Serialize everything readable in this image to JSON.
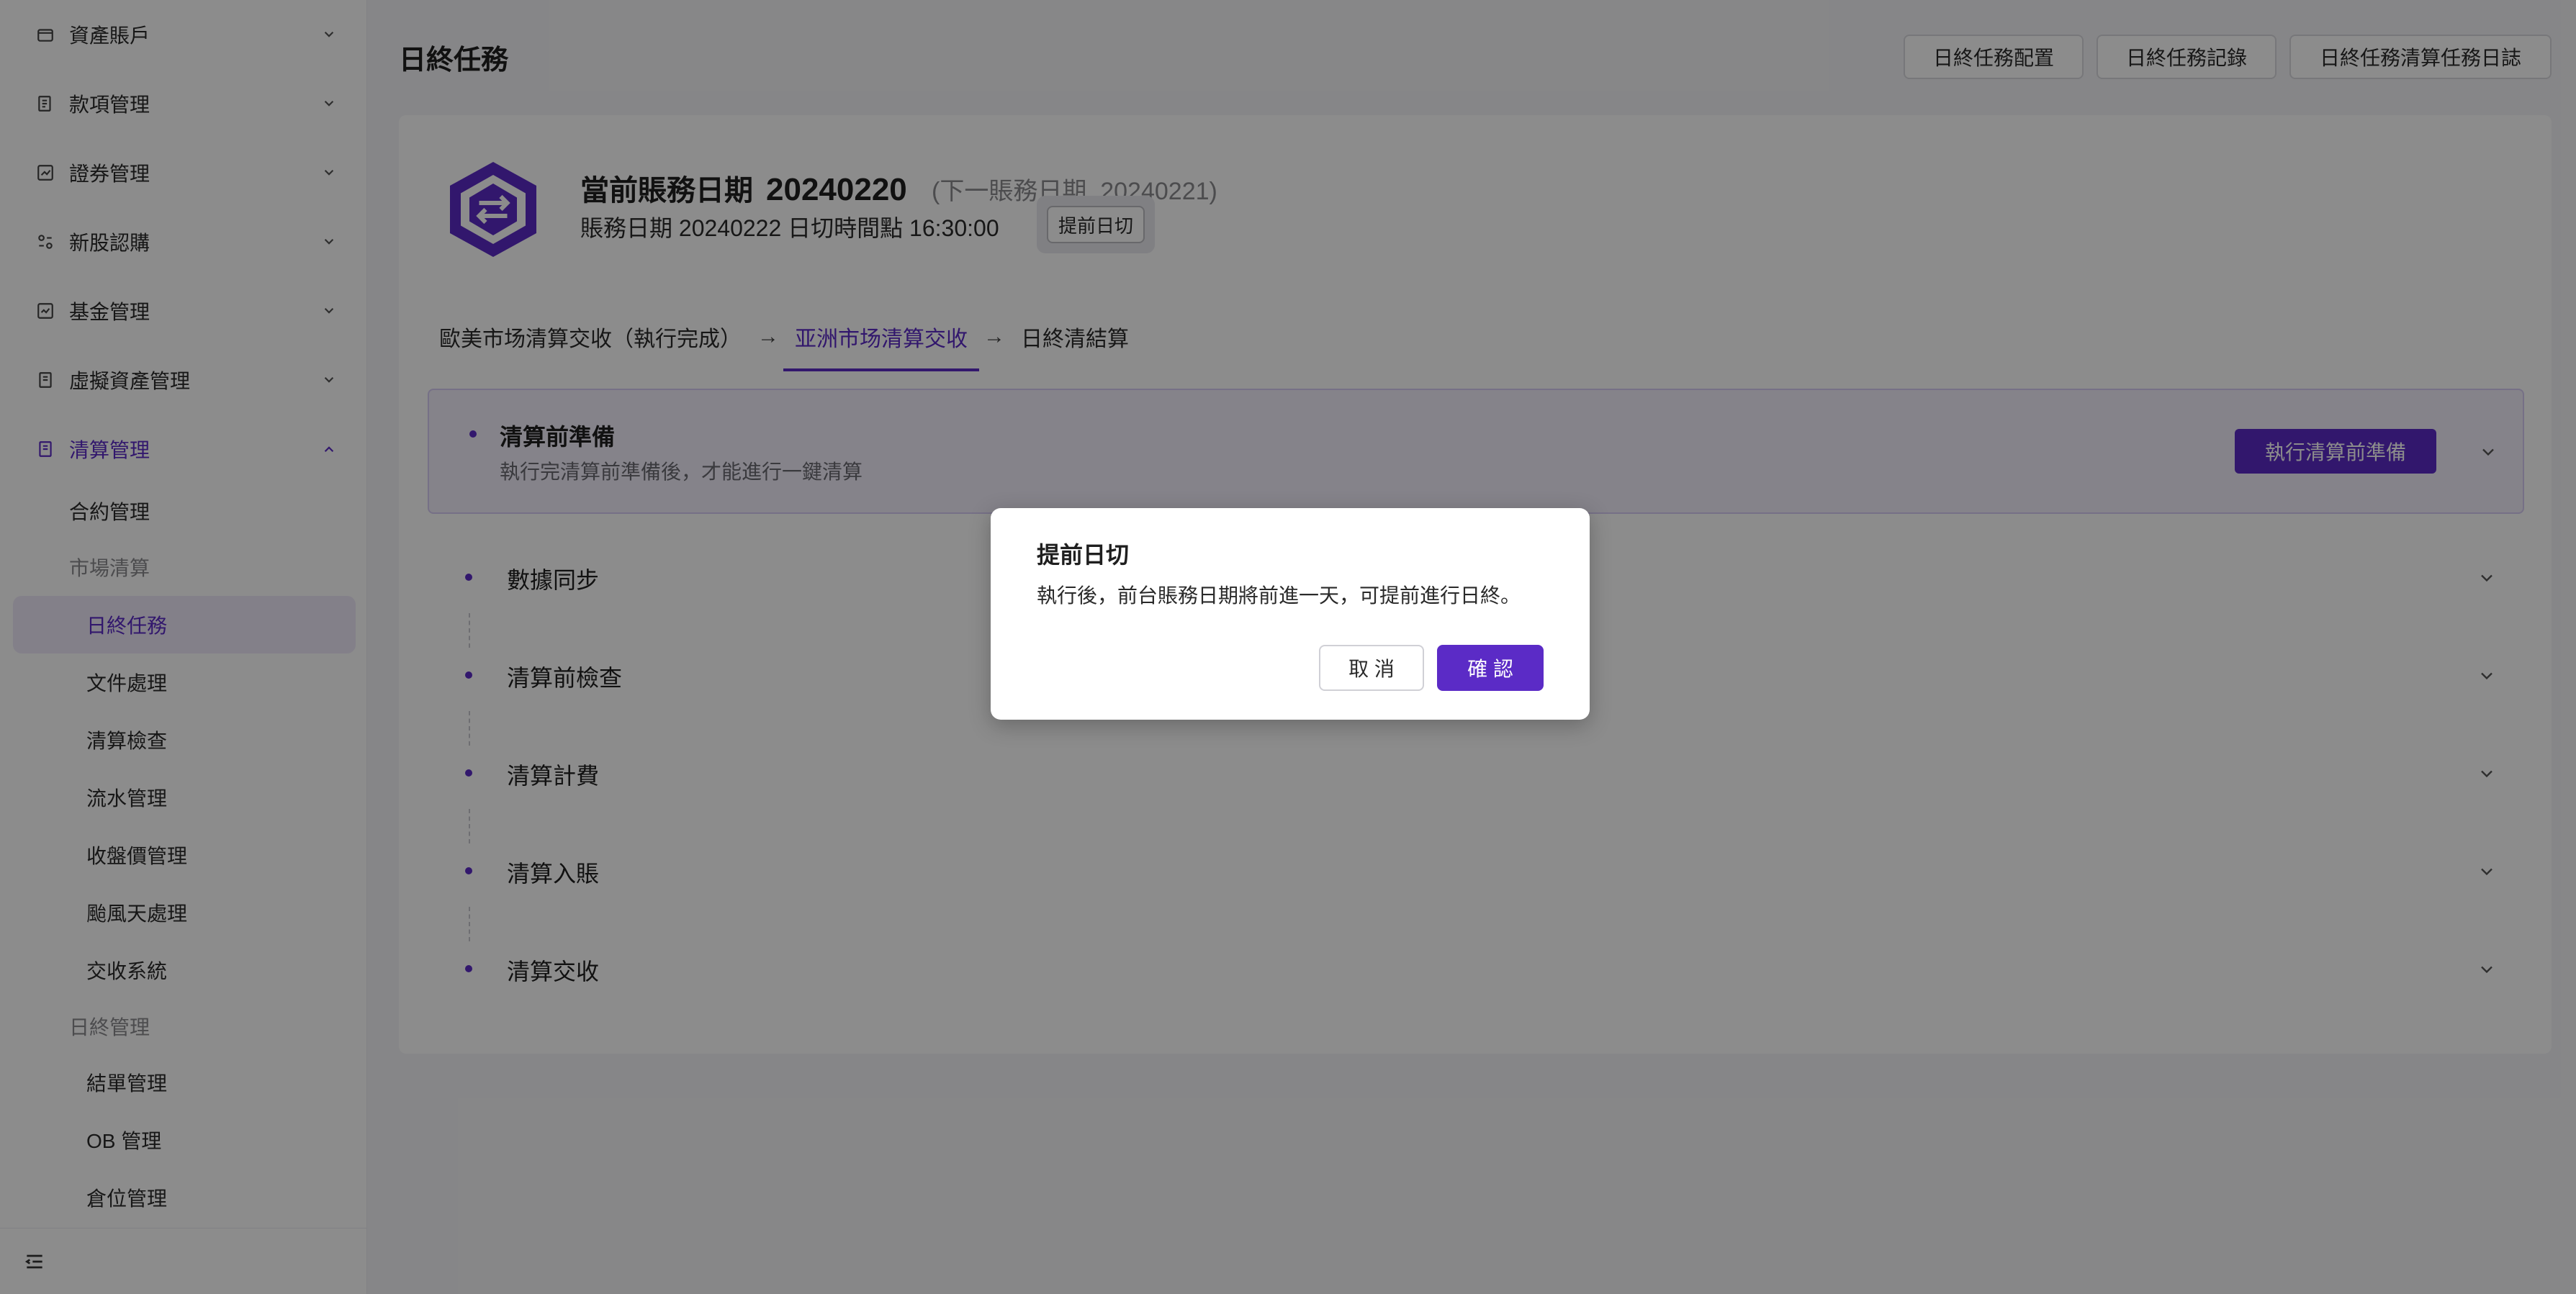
{
  "sidebar": {
    "items": [
      {
        "label": "資產賬戶",
        "icon": "wallet-icon"
      },
      {
        "label": "款項管理",
        "icon": "ledger-icon"
      },
      {
        "label": "證券管理",
        "icon": "chart-box-icon"
      },
      {
        "label": "新股認購",
        "icon": "ipo-icon"
      },
      {
        "label": "基金管理",
        "icon": "fund-icon"
      },
      {
        "label": "虛擬資產管理",
        "icon": "document-icon"
      },
      {
        "label": "清算管理",
        "icon": "settlement-icon",
        "active": true
      }
    ],
    "sub_items": [
      {
        "label": "合約管理"
      },
      {
        "label": "市場清算"
      },
      {
        "label": "日終任務"
      },
      {
        "label": "文件處理"
      },
      {
        "label": "清算檢查"
      },
      {
        "label": "流水管理"
      },
      {
        "label": "收盤價管理"
      },
      {
        "label": "颱風天處理"
      },
      {
        "label": "交收系統"
      },
      {
        "label": "日終管理"
      },
      {
        "label": "結單管理"
      },
      {
        "label": "OB 管理"
      },
      {
        "label": "倉位管理"
      }
    ]
  },
  "header": {
    "title": "日終任務",
    "buttons": [
      "日終任務配置",
      "日終任務記錄",
      "日終任務清算任務日誌"
    ]
  },
  "summary": {
    "current_label": "當前賬務日期",
    "current_date": "20240220",
    "next_label": "(下一賬務日期",
    "next_date": "20240221)",
    "sub_text": "賬務日期 20240222   日切時間點 16:30:00",
    "advance_button": "提前日切"
  },
  "steps": [
    "歐美市场清算交收（執行完成）",
    "亚洲市场清算交收",
    "日終清結算"
  ],
  "prep": {
    "title": "清算前準備",
    "desc": "執行完清算前準備後，才能進行一鍵清算",
    "button": "執行清算前準備"
  },
  "tasks": [
    "數據同步",
    "清算前檢查",
    "清算計費",
    "清算入賬",
    "清算交收"
  ],
  "modal": {
    "title": "提前日切",
    "body": "執行後，前台賬務日期將前進一天，可提前進行日終。",
    "cancel": "取 消",
    "confirm": "確 認"
  },
  "colors": {
    "accent": "#5b2bc6",
    "accent_light": "#f2eefb"
  }
}
